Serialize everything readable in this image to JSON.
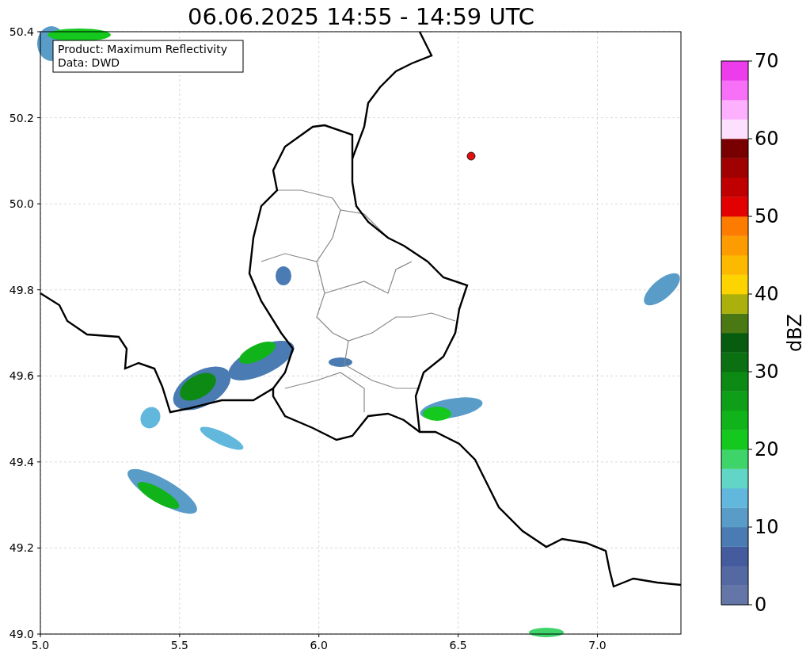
{
  "title": "06.06.2025 14:55 - 14:59 UTC",
  "info_box": [
    "Product: Maximum Reflectivity",
    "Data: DWD"
  ],
  "map": {
    "xticks": [
      "5.0",
      "5.5",
      "6.0",
      "6.5",
      "7.0"
    ],
    "yticks": [
      "50.4",
      "50.2",
      "50.0",
      "49.8",
      "49.6",
      "49.4",
      "49.2",
      "49.0"
    ]
  },
  "colorbar": {
    "label": "dBZ",
    "ticks": [
      "70",
      "60",
      "50",
      "40",
      "30",
      "20",
      "10",
      "0"
    ],
    "segments": [
      {
        "color": "#6476a8"
      },
      {
        "color": "#5468a2"
      },
      {
        "color": "#445c9e"
      },
      {
        "color": "#4a7bb2"
      },
      {
        "color": "#5a9cc8"
      },
      {
        "color": "#62b8dc"
      },
      {
        "color": "#62d6c6"
      },
      {
        "color": "#3ed46a"
      },
      {
        "color": "#14c81e"
      },
      {
        "color": "#10b41a"
      },
      {
        "color": "#0e9e18"
      },
      {
        "color": "#0c8a14"
      },
      {
        "color": "#0a7012"
      },
      {
        "color": "#085c10"
      },
      {
        "color": "#4a7812"
      },
      {
        "color": "#acb00c"
      },
      {
        "color": "#fed400"
      },
      {
        "color": "#fdb800"
      },
      {
        "color": "#fd9c00"
      },
      {
        "color": "#fd7c00"
      },
      {
        "color": "#e20000"
      },
      {
        "color": "#c00000"
      },
      {
        "color": "#a00000"
      },
      {
        "color": "#780000"
      },
      {
        "color": "#fde0fd"
      },
      {
        "color": "#fdb0fd"
      },
      {
        "color": "#f870f8"
      },
      {
        "color": "#ec3cec"
      }
    ]
  }
}
